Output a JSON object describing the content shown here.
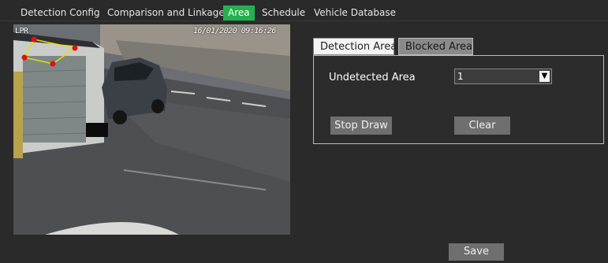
{
  "tabs": [
    {
      "label": "Detection Config"
    },
    {
      "label": "Comparison and Linkage"
    },
    {
      "label": "Area",
      "active": true
    },
    {
      "label": "Schedule"
    },
    {
      "label": "Vehicle Database"
    }
  ],
  "video": {
    "osd_label": "LPR",
    "osd_time": "16/01/2020 09:16:26"
  },
  "area_tabs": [
    {
      "label": "Detection Area",
      "selected": true
    },
    {
      "label": "Blocked Area",
      "selected": false
    }
  ],
  "panel": {
    "undetected_label": "Undetected Area",
    "undetected_value": "1",
    "stop_draw": "Stop Draw",
    "clear": "Clear"
  },
  "footer": {
    "save": "Save"
  },
  "colors": {
    "active_tab": "#23b14d",
    "polygon_line": "#e8e000",
    "polygon_point": "#e01010"
  }
}
